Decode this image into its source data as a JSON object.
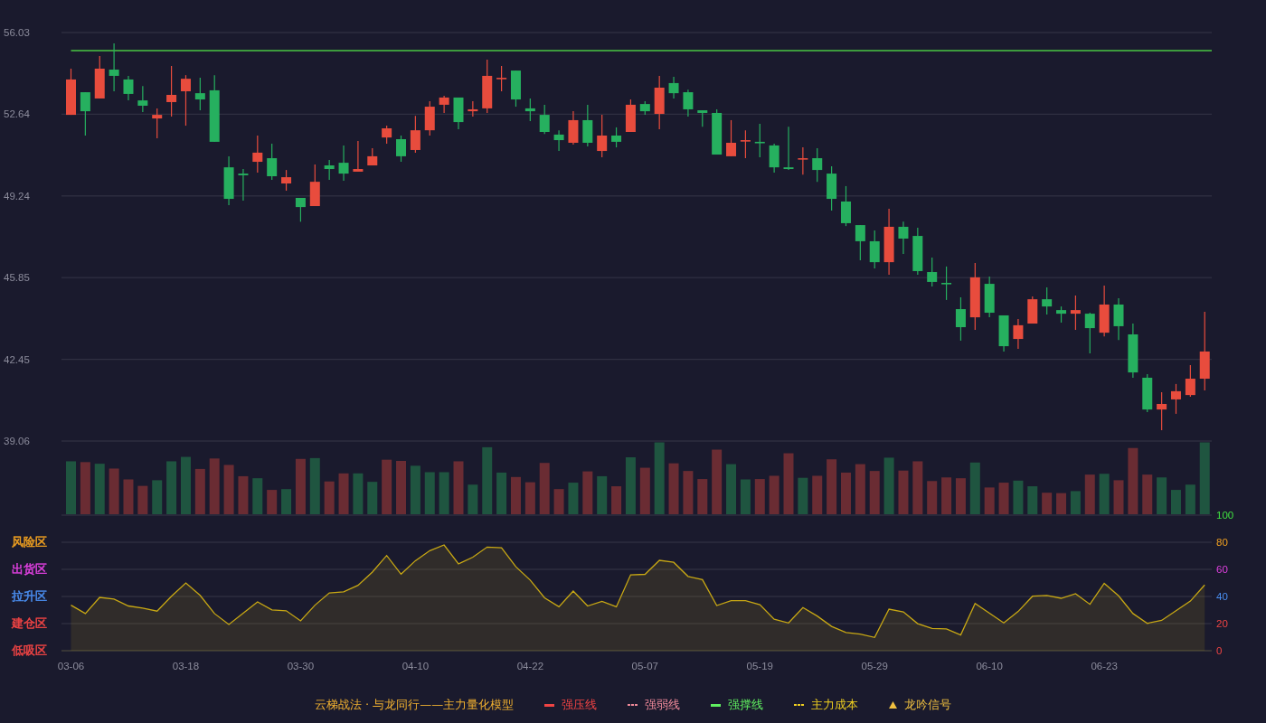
{
  "price_chart": {
    "chart_data": {
      "type": "candlestick",
      "grid": true,
      "categories": [
        null,
        null,
        null,
        null,
        null,
        null,
        null,
        null,
        null,
        null,
        null,
        null,
        null,
        null,
        null,
        null,
        null,
        null,
        null,
        null,
        null,
        null,
        null,
        null,
        null,
        null,
        null,
        null,
        null,
        null,
        null,
        null,
        null,
        null,
        null,
        null,
        null,
        null,
        null,
        null,
        null,
        null,
        null,
        null,
        null,
        null,
        null,
        null,
        null,
        null,
        null,
        null,
        null,
        null,
        null,
        null,
        null,
        null,
        null,
        null,
        null,
        null,
        null,
        null,
        null,
        null,
        null,
        null,
        null,
        null,
        null,
        null,
        null,
        null,
        null,
        null,
        null,
        null,
        null,
        null
      ],
      "ylim": [
        39.06,
        56.03
      ],
      "yticks": [
        56.03,
        52.64,
        49.24,
        45.85,
        42.45,
        39.06
      ],
      "ref_lines": [
        {
          "axis": "y",
          "value": 55.28,
          "color": "#3d9b3d"
        }
      ],
      "ohlc": [
        [
          52.61,
          54.53,
          52.61,
          54.08
        ],
        [
          53.55,
          53.55,
          51.75,
          52.76
        ],
        [
          53.29,
          55.05,
          53.29,
          54.53
        ],
        [
          54.49,
          55.58,
          53.59,
          54.23
        ],
        [
          54.08,
          54.23,
          53.21,
          53.48
        ],
        [
          53.21,
          53.81,
          52.73,
          52.99
        ],
        [
          52.46,
          52.88,
          51.64,
          52.61
        ],
        [
          53.14,
          54.64,
          52.54,
          53.44
        ],
        [
          53.59,
          54.26,
          52.16,
          54.11
        ],
        [
          53.51,
          54.15,
          52.8,
          53.25
        ],
        [
          53.63,
          54.26,
          51.49,
          51.49
        ],
        [
          50.43,
          50.89,
          48.86,
          49.12
        ],
        [
          50.17,
          50.36,
          49.05,
          50.1
        ],
        [
          50.66,
          51.75,
          50.21,
          51.04
        ],
        [
          50.81,
          51.41,
          49.91,
          50.06
        ],
        [
          49.76,
          50.32,
          49.46,
          50.02
        ],
        [
          49.16,
          49.16,
          48.17,
          48.78
        ],
        [
          48.82,
          50.55,
          48.82,
          49.83
        ],
        [
          50.51,
          50.74,
          49.91,
          50.36
        ],
        [
          50.62,
          51.34,
          49.87,
          50.17
        ],
        [
          50.25,
          51.52,
          50.25,
          50.36
        ],
        [
          50.51,
          51.22,
          50.51,
          50.89
        ],
        [
          51.67,
          52.16,
          51.41,
          52.05
        ],
        [
          51.6,
          51.75,
          50.66,
          50.89
        ],
        [
          51.15,
          52.57,
          51.04,
          51.97
        ],
        [
          51.97,
          53.18,
          51.75,
          52.95
        ],
        [
          53.03,
          53.4,
          52.69,
          53.33
        ],
        [
          53.33,
          53.33,
          52.01,
          52.31
        ],
        [
          52.76,
          53.18,
          52.54,
          52.84
        ],
        [
          52.88,
          54.9,
          52.69,
          54.23
        ],
        [
          54.11,
          54.64,
          53.59,
          54.15
        ],
        [
          54.45,
          54.45,
          52.95,
          53.25
        ],
        [
          52.88,
          53.29,
          52.35,
          52.76
        ],
        [
          52.61,
          53.03,
          51.82,
          51.9
        ],
        [
          51.79,
          51.97,
          51.11,
          51.56
        ],
        [
          51.45,
          52.76,
          51.37,
          52.39
        ],
        [
          52.39,
          53.03,
          51.3,
          51.45
        ],
        [
          51.11,
          52.61,
          50.85,
          51.75
        ],
        [
          51.75,
          52.09,
          51.26,
          51.49
        ],
        [
          51.9,
          53.25,
          51.9,
          53.03
        ],
        [
          53.06,
          53.18,
          52.61,
          52.76
        ],
        [
          52.65,
          54.23,
          52.01,
          53.74
        ],
        [
          53.93,
          54.19,
          53.29,
          53.51
        ],
        [
          53.55,
          53.66,
          52.54,
          52.84
        ],
        [
          52.8,
          52.8,
          52.12,
          52.69
        ],
        [
          52.69,
          52.84,
          50.96,
          50.96
        ],
        [
          50.89,
          52.39,
          50.89,
          51.45
        ],
        [
          51.52,
          51.97,
          50.81,
          51.56
        ],
        [
          51.49,
          52.24,
          50.85,
          51.45
        ],
        [
          51.34,
          51.41,
          50.21,
          50.43
        ],
        [
          50.43,
          52.12,
          50.32,
          50.36
        ],
        [
          50.77,
          51.26,
          50.13,
          50.81
        ],
        [
          50.81,
          51.22,
          49.83,
          50.32
        ],
        [
          50.17,
          50.47,
          48.63,
          49.12
        ],
        [
          49.01,
          49.65,
          47.99,
          48.11
        ],
        [
          48.03,
          48.03,
          46.57,
          47.36
        ],
        [
          47.36,
          47.81,
          46.23,
          46.49
        ],
        [
          46.49,
          48.71,
          45.97,
          47.96
        ],
        [
          47.96,
          48.17,
          46.83,
          47.47
        ],
        [
          47.58,
          47.92,
          45.97,
          46.12
        ],
        [
          46.08,
          46.68,
          45.48,
          45.67
        ],
        [
          45.63,
          46.31,
          44.92,
          45.59
        ],
        [
          44.54,
          45.03,
          43.23,
          43.79
        ],
        [
          44.2,
          46.46,
          43.68,
          45.86
        ],
        [
          45.59,
          45.89,
          44.2,
          44.39
        ],
        [
          44.28,
          44.28,
          42.78,
          43.0
        ],
        [
          43.3,
          44.13,
          42.89,
          43.87
        ],
        [
          43.94,
          45.07,
          43.94,
          44.95
        ],
        [
          44.95,
          45.44,
          44.32,
          44.65
        ],
        [
          44.5,
          44.65,
          43.98,
          44.35
        ],
        [
          44.35,
          45.1,
          43.68,
          44.5
        ],
        [
          44.35,
          44.39,
          42.7,
          43.75
        ],
        [
          43.56,
          45.52,
          43.41,
          44.73
        ],
        [
          44.73,
          44.99,
          43.26,
          43.83
        ],
        [
          43.49,
          43.94,
          41.69,
          41.91
        ],
        [
          41.69,
          41.84,
          40.26,
          40.37
        ],
        [
          40.37,
          41.09,
          39.51,
          40.6
        ],
        [
          40.79,
          41.43,
          40.19,
          41.13
        ],
        [
          40.97,
          42.21,
          40.9,
          41.65
        ],
        [
          41.65,
          44.43,
          41.16,
          42.78
        ]
      ]
    }
  },
  "indicator_chart": {
    "zones": [
      {
        "label": "风险区",
        "color": "#f0a020"
      },
      {
        "label": "出货区",
        "color": "#e040e0"
      },
      {
        "label": "拉升区",
        "color": "#4a8ef0"
      },
      {
        "label": "建仓区",
        "color": "#f04444"
      },
      {
        "label": "低吸区",
        "color": "#f04444"
      }
    ],
    "chart_data": {
      "type": "area",
      "grid": true,
      "categories": [
        "03-06",
        null,
        null,
        null,
        null,
        null,
        null,
        null,
        "03-18",
        null,
        null,
        null,
        null,
        null,
        null,
        null,
        "03-30",
        null,
        null,
        null,
        null,
        null,
        null,
        null,
        "04-10",
        null,
        null,
        null,
        null,
        null,
        null,
        null,
        "04-22",
        null,
        null,
        null,
        null,
        null,
        null,
        null,
        "05-07",
        null,
        null,
        null,
        null,
        null,
        null,
        null,
        "05-19",
        null,
        null,
        null,
        null,
        null,
        null,
        null,
        "05-29",
        null,
        null,
        null,
        null,
        null,
        null,
        null,
        "06-10",
        null,
        null,
        null,
        null,
        null,
        null,
        null,
        "06-23",
        null,
        null,
        null,
        null,
        null,
        null,
        null
      ],
      "ylim": [
        0,
        100
      ],
      "yticks": [
        {
          "value": 100,
          "label": "100"
        },
        {
          "value": 80,
          "label": "80"
        },
        {
          "value": 60,
          "label": "60"
        },
        {
          "value": 40,
          "label": "40"
        },
        {
          "value": 20,
          "label": "20"
        },
        {
          "value": 0,
          "label": "0"
        }
      ],
      "series": [
        {
          "color": "#c8a814",
          "values": [
            33.6,
            27.4,
            39.3,
            38.1,
            33.0,
            31.5,
            29.2,
            40.2,
            50.0,
            40.8,
            27.4,
            19.3,
            27.7,
            36.0,
            30.1,
            29.5,
            22.0,
            33.6,
            42.6,
            43.5,
            48.2,
            58.0,
            70.2,
            56.5,
            66.4,
            73.8,
            78.0,
            64.0,
            69.0,
            76.5,
            75.9,
            61.9,
            52.1,
            39.0,
            32.4,
            44.0,
            33.0,
            36.3,
            32.4,
            55.9,
            56.3,
            66.7,
            65.2,
            54.8,
            52.4,
            33.3,
            36.9,
            36.9,
            33.9,
            23.2,
            20.5,
            31.8,
            25.6,
            17.9,
            13.4,
            12.2,
            9.8,
            30.7,
            28.6,
            19.9,
            16.4,
            16.1,
            11.6,
            34.8,
            27.7,
            20.5,
            28.9,
            40.2,
            40.8,
            38.7,
            42.0,
            34.2,
            49.7,
            40.5,
            27.4,
            20.2,
            22.3,
            29.5,
            36.6,
            48.5
          ]
        }
      ]
    }
  },
  "legend": {
    "title": "云梯战法 · 与龙同行——主力量化模型",
    "items": [
      {
        "label": "强压线",
        "color": "#f04444",
        "kind": "solid"
      },
      {
        "label": "强弱线",
        "color": "#f08a9a",
        "kind": "dashed"
      },
      {
        "label": "强撑线",
        "color": "#60f060",
        "kind": "solid"
      },
      {
        "label": "主力成本",
        "color": "#f0d020",
        "kind": "dashed"
      },
      {
        "label": "龙吟信号",
        "color": "#f0c040",
        "kind": "triangle"
      }
    ]
  }
}
